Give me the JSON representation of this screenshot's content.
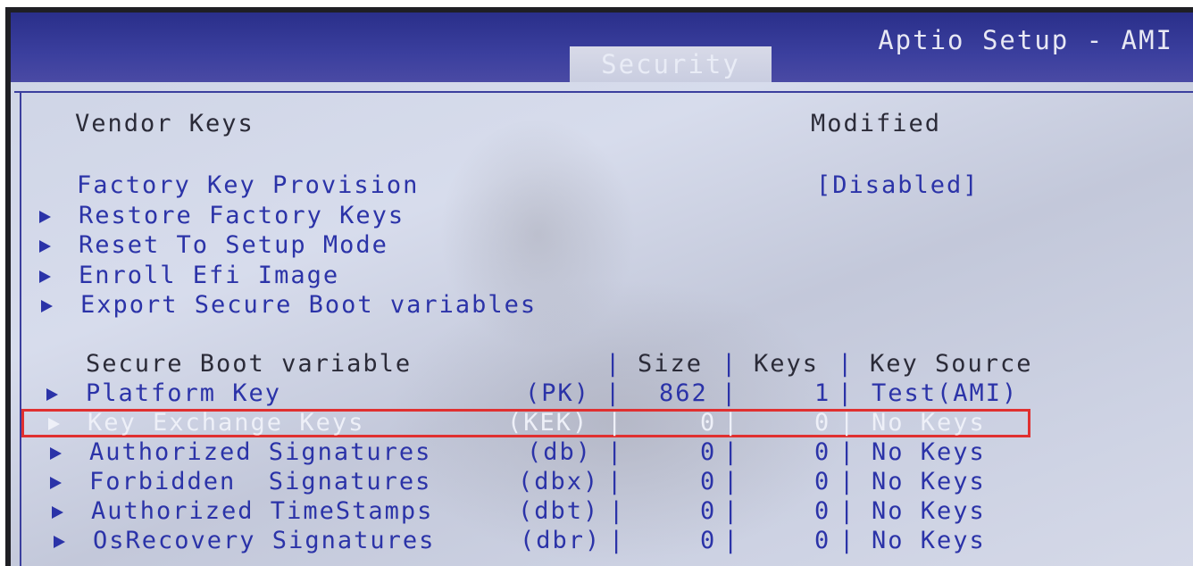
{
  "header": {
    "title": "Aptio Setup - AMI",
    "active_tab": "Security"
  },
  "vendor_keys": {
    "label": "Vendor Keys",
    "value": "Modified"
  },
  "menu": [
    {
      "label": "Factory Key Provision",
      "value": "[Disabled]",
      "submenu": false
    },
    {
      "label": "Restore Factory Keys",
      "submenu": true
    },
    {
      "label": "Reset To Setup Mode",
      "submenu": true
    },
    {
      "label": "Enroll Efi Image",
      "submenu": true
    },
    {
      "label": "Export Secure Boot variables",
      "submenu": true
    }
  ],
  "table": {
    "headers": [
      "Secure Boot variable",
      "Size",
      "Keys",
      "Key Source"
    ],
    "rows": [
      {
        "name": "Platform Key",
        "abbr": "(PK)",
        "size": "862",
        "keys": "1",
        "source": "Test(AMI)"
      },
      {
        "name": "Key Exchange Keys",
        "abbr": "(KEK)",
        "size": "0",
        "keys": "0",
        "source": "No Keys",
        "selected": true
      },
      {
        "name": "Authorized Signatures",
        "abbr": "(db)",
        "size": "0",
        "keys": "0",
        "source": "No Keys"
      },
      {
        "name": "Forbidden  Signatures",
        "abbr": "(dbx)",
        "size": "0",
        "keys": "0",
        "source": "No Keys"
      },
      {
        "name": "Authorized TimeStamps",
        "abbr": "(dbt)",
        "size": "0",
        "keys": "0",
        "source": "No Keys"
      },
      {
        "name": "OsRecovery Signatures",
        "abbr": "(dbr)",
        "size": "0",
        "keys": "0",
        "source": "No Keys"
      }
    ]
  },
  "colors": {
    "header_bg": "#3b3f9e",
    "screen_bg": "#cfd5e6",
    "item_text": "#2b33a8",
    "static_text": "#2b2b38",
    "highlight_box": "#e03030"
  }
}
